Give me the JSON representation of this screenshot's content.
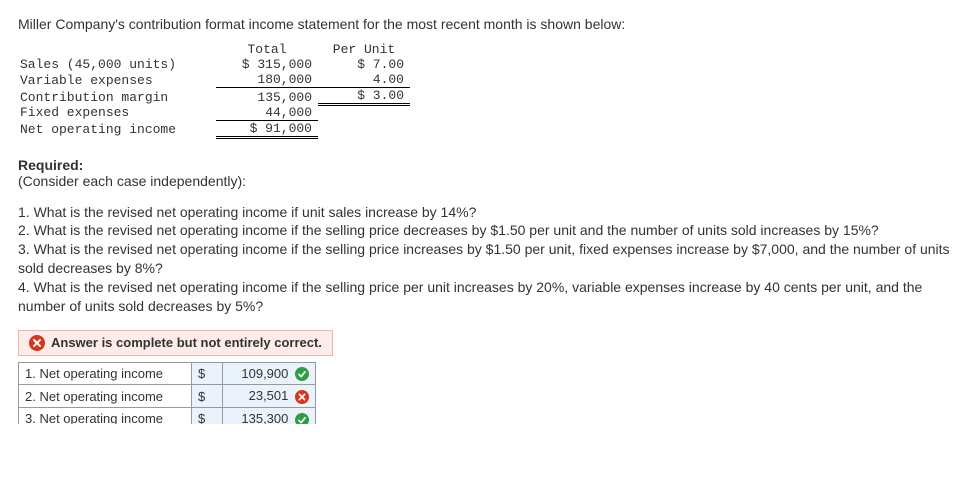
{
  "intro": "Miller Company's contribution format income statement for the most recent month is shown below:",
  "income_statement": {
    "headers": {
      "total": "Total",
      "per_unit": "Per Unit"
    },
    "rows": {
      "sales": {
        "label": "Sales (45,000 units)",
        "total": "$ 315,000",
        "per_unit": "$ 7.00"
      },
      "varexp": {
        "label": "Variable expenses",
        "total": "180,000",
        "per_unit": "4.00"
      },
      "cm": {
        "label": "Contribution margin",
        "total": "135,000",
        "per_unit": "$ 3.00"
      },
      "fixed": {
        "label": "Fixed expenses",
        "total": "44,000"
      },
      "noi": {
        "label": "Net operating income",
        "total": "$ 91,000"
      }
    }
  },
  "required_label": "Required:",
  "consider": "(Consider each case independently):",
  "q1": "1. What is the revised net operating income if unit sales increase by 14%?",
  "q2": "2. What is the revised net operating income if the selling price decreases by $1.50 per unit and the number of units sold increases by 15%?",
  "q3": "3. What is the revised net operating income if the selling price increases by $1.50 per unit, fixed expenses increase by $7,000, and the number of units sold decreases by 8%?",
  "q4": "4. What is the revised net operating income if the selling price per unit increases by 20%, variable expenses increase by 40 cents per unit, and the number of units sold decreases by 5%?",
  "feedback": "Answer is complete but not entirely correct.",
  "answers": {
    "r1": {
      "label": "1. Net operating income",
      "cur": "$",
      "val": "109,900",
      "status": "correct"
    },
    "r2": {
      "label": "2. Net operating income",
      "cur": "$",
      "val": "23,501",
      "status": "incorrect"
    },
    "r3": {
      "label": "3. Net operating income",
      "cur": "$",
      "val": "135,300",
      "status": "correct"
    }
  }
}
